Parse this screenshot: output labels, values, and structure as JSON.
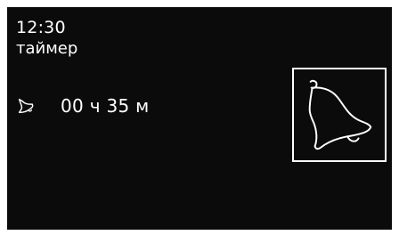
{
  "status": {
    "time": "12:30",
    "mode": "таймер"
  },
  "timer": {
    "value": "00 ч 35 м",
    "icon": "bell-icon"
  },
  "alarm_button": {
    "icon": "bell-icon"
  },
  "colors": {
    "background": "#0b0b0b",
    "foreground": "#ffffff"
  }
}
